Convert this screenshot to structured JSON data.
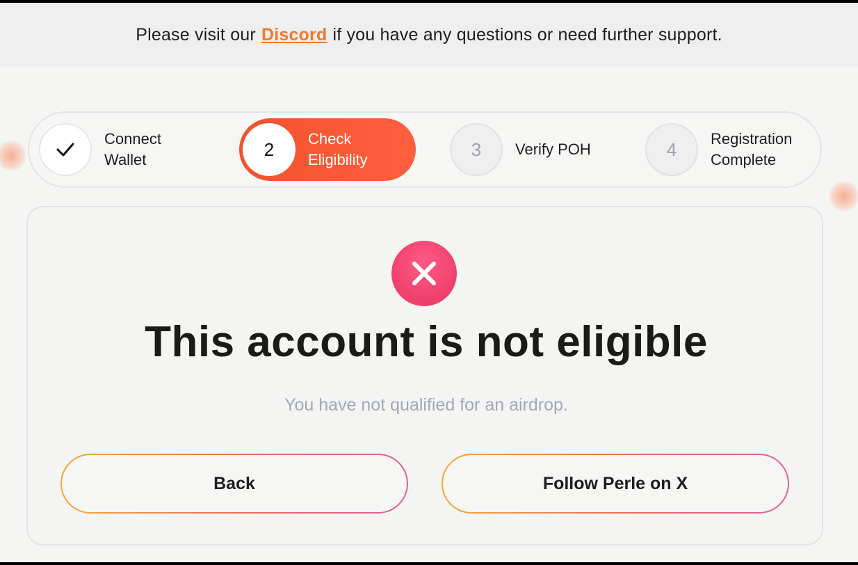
{
  "banner": {
    "prefix": "Please visit our",
    "link": "Discord",
    "suffix": "if you have any questions or need further support."
  },
  "stepper": {
    "steps": [
      {
        "marker": "check-icon",
        "label_line1": "Connect",
        "label_line2": "Wallet",
        "state": "completed"
      },
      {
        "marker": "2",
        "label_line1": "Check",
        "label_line2": "Eligibility",
        "state": "active"
      },
      {
        "marker": "3",
        "label": "Verify POH",
        "state": "pending"
      },
      {
        "marker": "4",
        "label_line1": "Registration",
        "label_line2": "Complete",
        "state": "pending"
      }
    ]
  },
  "result": {
    "icon": "x-circle-icon",
    "title": "This account is not eligible",
    "message": "You have not qualified for an airdrop."
  },
  "actions": {
    "back_label": "Back",
    "follow_label": "Follow Perle on X"
  },
  "colors": {
    "accent": "#f2522d",
    "link": "#f07a2a",
    "error": "#ef3f6b",
    "muted_text": "#a3a8b6"
  }
}
